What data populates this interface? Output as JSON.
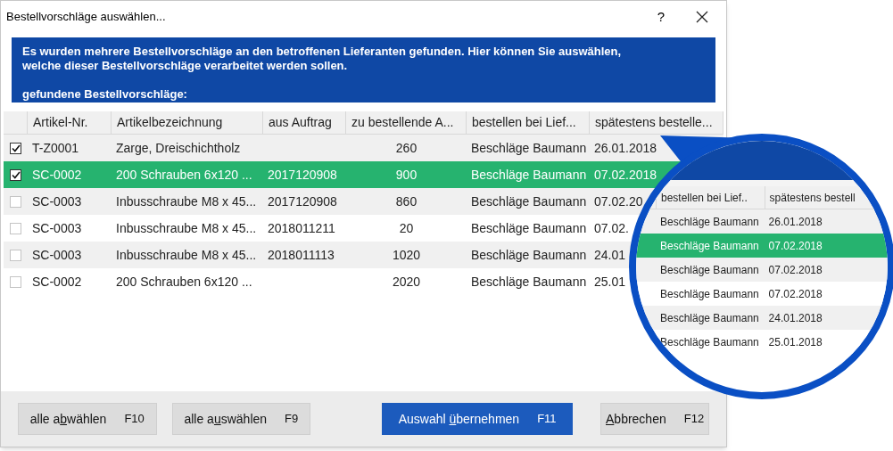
{
  "window": {
    "title": "Bestellvorschläge auswählen...",
    "help": "?"
  },
  "banner": {
    "text": "Es wurden mehrere Bestellvorschläge an den betroffenen Lieferanten gefunden. Hier können Sie auswählen, welche dieser Bestellvorschläge verarbeitet werden sollen.",
    "subheading": "gefundene Bestellvorschläge:"
  },
  "table": {
    "columns": [
      "Artikel-Nr.",
      "Artikelbezeichnung",
      "aus Auftrag",
      "zu bestellende A...",
      "bestellen bei Lief...",
      "spätestens bestelle..."
    ],
    "rows": [
      {
        "checked": true,
        "selected": false,
        "cells": [
          "T-Z0001",
          "Zarge, Dreischichtholz",
          "",
          "260",
          "Beschläge Baumann",
          "26.01.2018"
        ]
      },
      {
        "checked": true,
        "selected": true,
        "cells": [
          "SC-0002",
          "200 Schrauben 6x120 ...",
          "2017120908",
          "900",
          "Beschläge Baumann",
          "07.02.2018"
        ]
      },
      {
        "checked": false,
        "selected": false,
        "cells": [
          "SC-0003",
          "Inbusschraube M8 x 45...",
          "2017120908",
          "860",
          "Beschläge Baumann",
          "07.02.20"
        ]
      },
      {
        "checked": false,
        "selected": false,
        "cells": [
          "SC-0003",
          "Inbusschraube M8 x 45...",
          "2018011211",
          "20",
          "Beschläge Baumann",
          "07.02."
        ]
      },
      {
        "checked": false,
        "selected": false,
        "cells": [
          "SC-0003",
          "Inbusschraube M8 x 45...",
          "2018011113",
          "1020",
          "Beschläge Baumann",
          "24.01"
        ]
      },
      {
        "checked": false,
        "selected": false,
        "cells": [
          "SC-0002",
          "200 Schrauben 6x120 ...",
          "",
          "2020",
          "Beschläge Baumann",
          "25.01"
        ]
      }
    ]
  },
  "buttons": [
    {
      "label": {
        "before": "alle a",
        "mnemonic": "b",
        "after": "wählen"
      },
      "key": "F10",
      "primary": false
    },
    {
      "label": {
        "before": "alle a",
        "mnemonic": "u",
        "after": "swählen"
      },
      "key": "F9",
      "primary": false
    },
    {
      "label": {
        "before": "Auswahl ",
        "mnemonic": "ü",
        "after": "bernehmen"
      },
      "key": "F11",
      "primary": true
    },
    {
      "label": {
        "mnemonic": "A",
        "after": "bbrechen"
      },
      "key": "F12",
      "primary": false
    }
  ],
  "magnifier": {
    "columns": [
      "bestellen bei Lief..",
      "spätestens bestell"
    ],
    "rows": [
      {
        "selected": false,
        "cells": [
          "Beschläge Baumann",
          "26.01.2018"
        ]
      },
      {
        "selected": true,
        "cells": [
          "Beschläge Baumann",
          "07.02.2018"
        ]
      },
      {
        "selected": false,
        "cells": [
          "Beschläge Baumann",
          "07.02.2018"
        ]
      },
      {
        "selected": false,
        "cells": [
          "Beschläge Baumann",
          "07.02.2018"
        ]
      },
      {
        "selected": false,
        "cells": [
          "Beschläge Baumann",
          "24.01.2018"
        ]
      },
      {
        "selected": false,
        "cells": [
          "Beschläge Baumann",
          "25.01.2018"
        ]
      }
    ]
  }
}
